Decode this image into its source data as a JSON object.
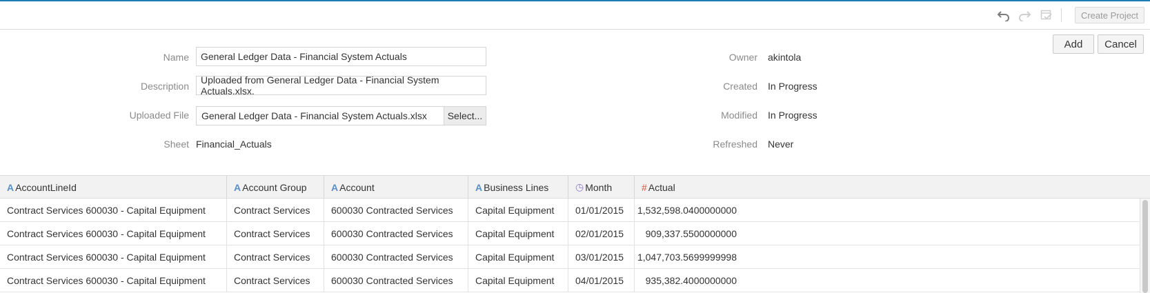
{
  "toolbar": {
    "create_project_label": "Create Project",
    "icons": [
      "undo-icon",
      "redo-icon",
      "validate-icon"
    ]
  },
  "actions": {
    "add_label": "Add",
    "cancel_label": "Cancel"
  },
  "form": {
    "name_label": "Name",
    "name_value": "General Ledger Data - Financial System Actuals",
    "description_label": "Description",
    "description_value": "Uploaded from General Ledger Data - Financial System Actuals.xlsx.",
    "file_label": "Uploaded File",
    "file_value": "General Ledger Data - Financial System Actuals.xlsx",
    "file_select_label": "Select...",
    "sheet_label": "Sheet",
    "sheet_value": "Financial_Actuals",
    "owner_label": "Owner",
    "owner_value": "akintola",
    "created_label": "Created",
    "created_value": "In Progress",
    "modified_label": "Modified",
    "modified_value": "In Progress",
    "refreshed_label": "Refreshed",
    "refreshed_value": "Never"
  },
  "table": {
    "columns": [
      {
        "label": "AccountLineId",
        "type_icon": "A",
        "icon_name": "text-type-icon",
        "color": "#5b8fc7"
      },
      {
        "label": "Account Group",
        "type_icon": "A",
        "icon_name": "text-type-icon",
        "color": "#5b8fc7"
      },
      {
        "label": "Account",
        "type_icon": "A",
        "icon_name": "text-type-icon",
        "color": "#5b8fc7"
      },
      {
        "label": "Business Lines",
        "type_icon": "A",
        "icon_name": "text-type-icon",
        "color": "#5b8fc7"
      },
      {
        "label": "Month",
        "type_icon": "◷",
        "icon_name": "clock-type-icon",
        "color": "#8c79c4"
      },
      {
        "label": "Actual",
        "type_icon": "#",
        "icon_name": "number-type-icon",
        "color": "#e07a6b"
      }
    ],
    "rows": [
      [
        "Contract Services 600030 - Capital Equipment",
        "Contract Services",
        "600030 Contracted Services",
        "Capital Equipment",
        "01/01/2015",
        "1,532,598.0400000000"
      ],
      [
        "Contract Services 600030 - Capital Equipment",
        "Contract Services",
        "600030 Contracted Services",
        "Capital Equipment",
        "02/01/2015",
        "909,337.5500000000"
      ],
      [
        "Contract Services 600030 - Capital Equipment",
        "Contract Services",
        "600030 Contracted Services",
        "Capital Equipment",
        "03/01/2015",
        "1,047,703.5699999998"
      ],
      [
        "Contract Services 600030 - Capital Equipment",
        "Contract Services",
        "600030 Contracted Services",
        "Capital Equipment",
        "04/01/2015",
        "935,382.4000000000"
      ]
    ]
  }
}
